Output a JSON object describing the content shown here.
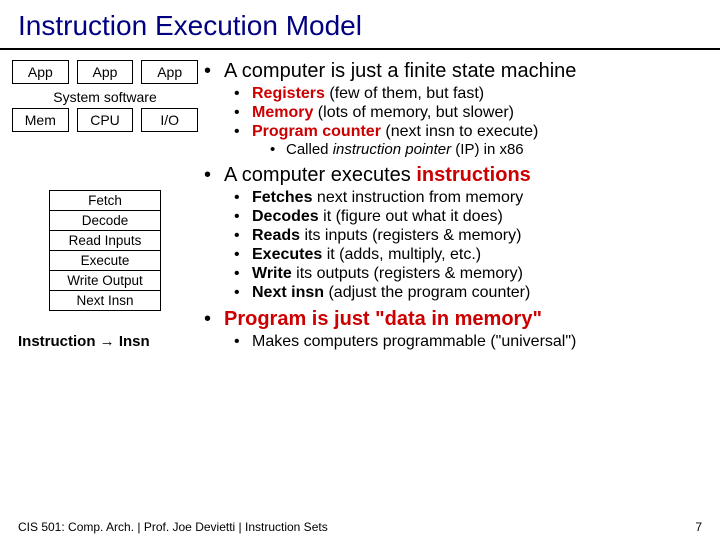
{
  "title": "Instruction Execution Model",
  "diagram": {
    "app": "App",
    "system_software": "System software",
    "mem": "Mem",
    "cpu": "CPU",
    "io": "I/O"
  },
  "pipeline": [
    "Fetch",
    "Decode",
    "Read Inputs",
    "Execute",
    "Write Output",
    "Next Insn"
  ],
  "insn_eq_a": "Instruction",
  "insn_eq_arrow": "→",
  "insn_eq_b": "Insn",
  "main1": "A computer is just a finite state machine",
  "sub1": [
    {
      "b": "Registers",
      "rest": " (few of them, but fast)"
    },
    {
      "b": "Memory",
      "rest": " (lots of memory, but slower)"
    },
    {
      "b": "Program counter",
      "rest": " (next insn to execute)"
    }
  ],
  "sub1_sub": {
    "pre": "Called ",
    "ital": "instruction pointer",
    "post": " (IP) in x86"
  },
  "main2_pre": "A computer executes ",
  "main2_red": "instructions",
  "sub2": [
    {
      "b": "Fetches",
      "rest": " next instruction from memory"
    },
    {
      "b": "Decodes",
      "rest": " it (figure out what it does)"
    },
    {
      "b": "Reads",
      "rest": " its inputs (registers & memory)"
    },
    {
      "b": "Executes",
      "rest": " it (adds, multiply, etc.)"
    },
    {
      "b": "Write",
      "rest": " its outputs (registers & memory)"
    },
    {
      "b": "Next insn",
      "rest": " (adjust the program counter)"
    }
  ],
  "main3": "Program is just \"data in memory\"",
  "sub3": "Makes computers programmable (\"universal\")",
  "footer_left": "CIS 501: Comp. Arch.  |  Prof. Joe Devietti  |  Instruction Sets",
  "footer_right": "7"
}
